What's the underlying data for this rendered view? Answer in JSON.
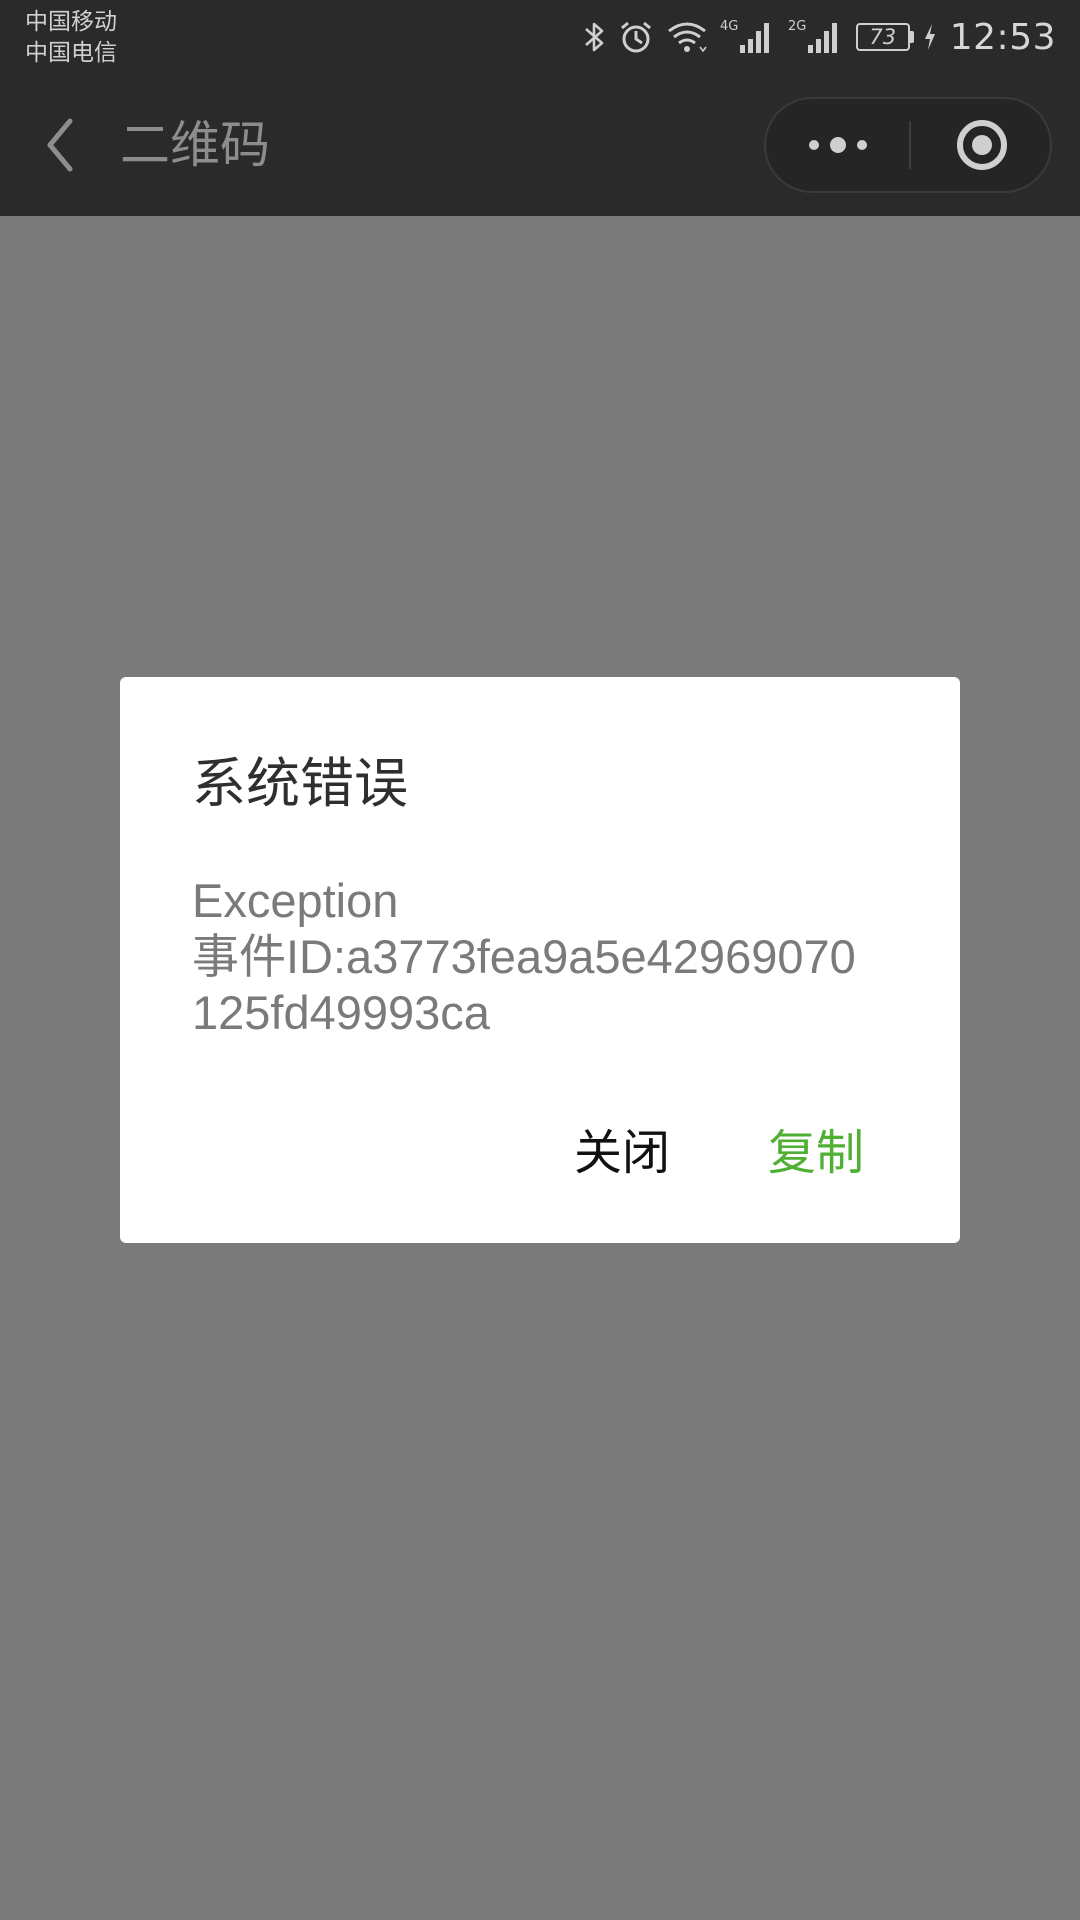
{
  "status_bar": {
    "carriers": [
      "中国移动",
      "中国电信"
    ],
    "icons": [
      "bluetooth-icon",
      "alarm-icon",
      "wifi-icon",
      "signal-4g-icon",
      "signal-2g-icon",
      "battery-icon",
      "charging-icon"
    ],
    "network_labels": [
      "4G",
      "2G"
    ],
    "battery_level": "73",
    "time": "12:53"
  },
  "nav_bar": {
    "title": "二维码",
    "back_icon": "chevron-left-icon",
    "more_icon": "more-dots-icon",
    "close_icon": "target-circle-icon"
  },
  "dialog": {
    "title": "系统错误",
    "body_lines": [
      "Exception",
      "事件ID:a3773fea9a5e42969070",
      "125fd49993ca"
    ],
    "buttons": {
      "close_label": "关闭",
      "copy_label": "复制"
    }
  },
  "colors": {
    "status_bg": "#2a2a2a",
    "overlay": "#7a7a7a",
    "dialog_bg": "#ffffff",
    "accent_green": "#4fb034"
  }
}
